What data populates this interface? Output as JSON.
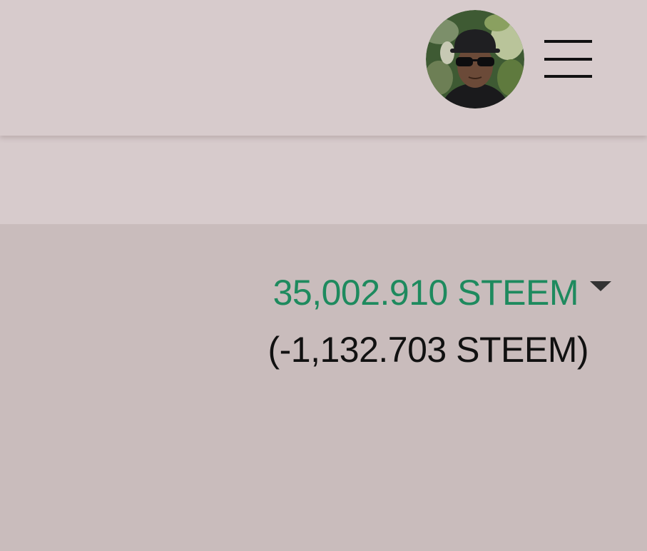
{
  "header": {
    "avatar_alt": "User avatar",
    "menu_icon": "hamburger-menu-icon"
  },
  "wallet": {
    "balance": "35,002.910 STEEM",
    "balance_change": "(-1,132.703 STEEM)",
    "caret_icon": "caret-down-icon",
    "colors": {
      "balance": "#1e8a5e",
      "change": "#111111"
    }
  }
}
